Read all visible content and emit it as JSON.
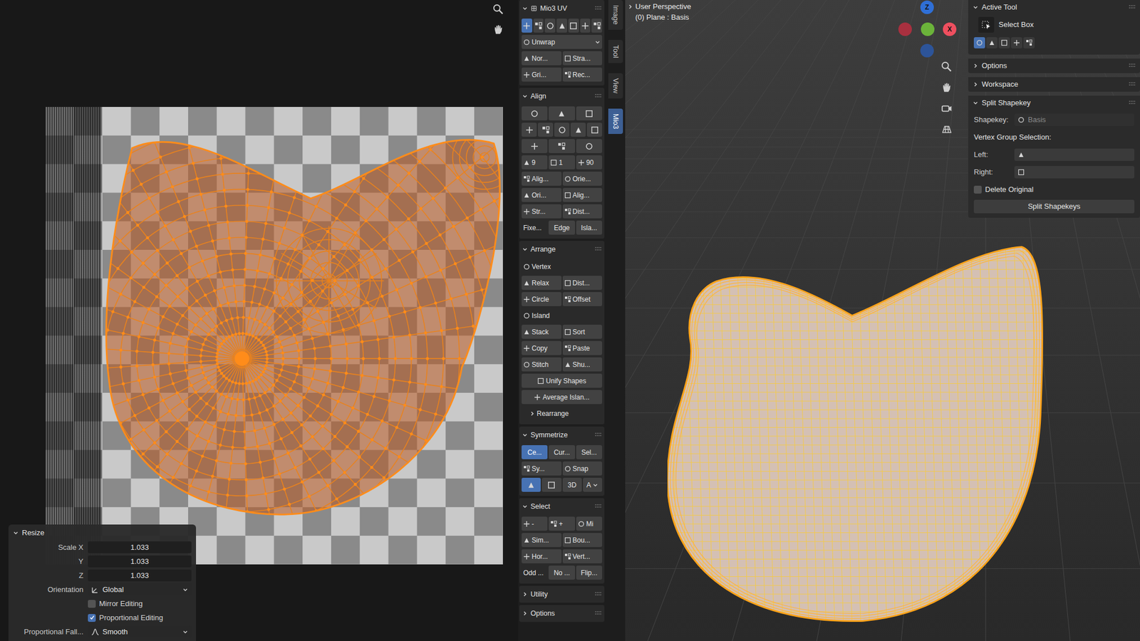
{
  "uv_editor": {
    "operator_panel": {
      "title": "Resize",
      "expanded": true,
      "fields": [
        {
          "label": "Scale X",
          "value": "1.033"
        },
        {
          "label": "Y",
          "value": "1.033"
        },
        {
          "label": "Z",
          "value": "1.033"
        }
      ],
      "orientation": {
        "label": "Orientation",
        "value": "Global"
      },
      "checkboxes": [
        {
          "label": "Mirror Editing",
          "checked": false
        },
        {
          "label": "Proportional Editing",
          "checked": true
        }
      ],
      "falloff": {
        "label": "Proportional Fall...",
        "value": "Smooth"
      }
    }
  },
  "mio3_panel": {
    "sections": [
      {
        "title": "Mio3 UV",
        "expanded": true,
        "rows": [
          [
            {
              "kind": "icon",
              "selected": true
            },
            {
              "kind": "icon",
              "selected": false
            },
            {
              "kind": "icon",
              "selected": false
            },
            {
              "kind": "icon",
              "selected": false
            },
            {
              "kind": "icon",
              "selected": false
            },
            {
              "kind": "icon",
              "selected": false
            },
            {
              "kind": "icon",
              "selected": false
            }
          ],
          [
            {
              "kind": "dropdown",
              "label": "Unwrap"
            }
          ],
          [
            {
              "kind": "button",
              "label": "Nor..."
            },
            {
              "kind": "button",
              "label": "Stra..."
            }
          ],
          [
            {
              "kind": "button",
              "label": "Gri..."
            },
            {
              "kind": "button",
              "label": "Rec..."
            }
          ]
        ]
      },
      {
        "title": "Align",
        "expanded": true,
        "rows": [
          [
            {
              "kind": "icon"
            },
            {
              "kind": "icon"
            },
            {
              "kind": "icon"
            }
          ],
          [
            {
              "kind": "icon"
            },
            {
              "kind": "icon"
            },
            {
              "kind": "icon"
            },
            {
              "kind": "icon"
            },
            {
              "kind": "icon"
            }
          ],
          [
            {
              "kind": "icon"
            },
            {
              "kind": "icon"
            },
            {
              "kind": "icon"
            }
          ],
          [
            {
              "kind": "button",
              "label": "9"
            },
            {
              "kind": "button",
              "label": "1"
            },
            {
              "kind": "button",
              "label": "90"
            }
          ],
          [
            {
              "kind": "button",
              "label": "Alig..."
            },
            {
              "kind": "button",
              "label": "Orie..."
            }
          ],
          [
            {
              "kind": "button",
              "label": "Ori..."
            },
            {
              "kind": "button",
              "label": "Alig..."
            }
          ],
          [
            {
              "kind": "button",
              "label": "Str..."
            },
            {
              "kind": "button",
              "label": "Dist..."
            }
          ],
          [
            {
              "kind": "label",
              "label": "Fixe..."
            },
            {
              "kind": "plain",
              "label": "Edge"
            },
            {
              "kind": "plain",
              "label": "Isla..."
            }
          ]
        ]
      },
      {
        "title": "Arrange",
        "expanded": true,
        "rows": [
          [
            {
              "kind": "heading",
              "label": "Vertex"
            }
          ],
          [
            {
              "kind": "button",
              "label": "Relax"
            },
            {
              "kind": "button",
              "label": "Dist..."
            }
          ],
          [
            {
              "kind": "button",
              "label": "Circle"
            },
            {
              "kind": "button",
              "label": "Offset"
            }
          ],
          [
            {
              "kind": "heading",
              "label": "Island"
            }
          ],
          [
            {
              "kind": "button",
              "label": "Stack"
            },
            {
              "kind": "button",
              "label": "Sort"
            }
          ],
          [
            {
              "kind": "button",
              "label": "Copy"
            },
            {
              "kind": "button",
              "label": "Paste"
            }
          ],
          [
            {
              "kind": "button",
              "label": "Stitch"
            },
            {
              "kind": "button",
              "label": "Shu..."
            }
          ],
          [
            {
              "kind": "button",
              "label": "Unify Shapes"
            }
          ],
          [
            {
              "kind": "button",
              "label": "Average Islan..."
            }
          ],
          [
            {
              "kind": "subpanel",
              "label": "Rearrange",
              "expanded": false
            }
          ]
        ]
      },
      {
        "title": "Symmetrize",
        "expanded": true,
        "rows": [
          [
            {
              "kind": "toggle",
              "label": "Ce...",
              "selected": true
            },
            {
              "kind": "toggle",
              "label": "Cur...",
              "selected": false
            },
            {
              "kind": "toggle",
              "label": "Sel...",
              "selected": false
            }
          ],
          [
            {
              "kind": "button",
              "label": "Sy..."
            },
            {
              "kind": "button",
              "label": "Snap"
            }
          ],
          [
            {
              "kind": "icon",
              "selected": true
            },
            {
              "kind": "icon",
              "selected": false
            },
            {
              "kind": "plain",
              "label": "3D"
            },
            {
              "kind": "dropdown",
              "label": "A"
            }
          ]
        ]
      },
      {
        "title": "Select",
        "expanded": true,
        "rows": [
          [
            {
              "kind": "button",
              "label": "-"
            },
            {
              "kind": "button",
              "label": "+"
            },
            {
              "kind": "button",
              "label": "Mi"
            }
          ],
          [
            {
              "kind": "button",
              "label": "Sim..."
            },
            {
              "kind": "button",
              "label": "Bou..."
            }
          ],
          [
            {
              "kind": "button",
              "label": "Hor..."
            },
            {
              "kind": "button",
              "label": "Vert..."
            }
          ],
          [
            {
              "kind": "label",
              "label": "Odd ..."
            },
            {
              "kind": "plain",
              "label": "No ..."
            },
            {
              "kind": "plain",
              "label": "Flip..."
            }
          ]
        ]
      },
      {
        "title": "Utility",
        "expanded": false,
        "rows": []
      },
      {
        "title": "Options",
        "expanded": false,
        "rows": []
      }
    ]
  },
  "side_tabs": [
    {
      "label": "Image",
      "selected": false
    },
    {
      "label": "Tool",
      "selected": false
    },
    {
      "label": "View",
      "selected": false
    },
    {
      "label": "Mio3",
      "selected": true
    }
  ],
  "viewport": {
    "lines": [
      "User Perspective",
      "(0) Plane : Basis"
    ],
    "gizmo": [
      {
        "kind": "axis",
        "label": "Z",
        "color": "#2f6fd6"
      },
      {
        "kind": "axis",
        "label": "X",
        "color": "#ef4f5f"
      },
      {
        "kind": "ball",
        "color": "#6bb33a"
      },
      {
        "kind": "ball",
        "color": "#a8303f"
      },
      {
        "kind": "ball",
        "color": "#2d5499"
      }
    ]
  },
  "n_panel": {
    "active_tool": {
      "title": "Active Tool",
      "expanded": true,
      "tool": "Select Box",
      "modes": [
        {
          "selected": true
        },
        {
          "selected": false
        },
        {
          "selected": false
        },
        {
          "selected": false
        },
        {
          "selected": false
        }
      ]
    },
    "collapsed": [
      {
        "title": "Options",
        "expanded": false
      },
      {
        "title": "Workspace",
        "expanded": false
      }
    ],
    "split_shapekey": {
      "title": "Split Shapekey",
      "expanded": true,
      "shapekey_label": "Shapekey:",
      "shapekey_value": "Basis",
      "shapekey_disabled": true,
      "group_heading": "Vertex Group Selection:",
      "left_label": "Left:",
      "right_label": "Right:",
      "delete_original": {
        "label": "Delete Original",
        "checked": false
      },
      "button": "Split Shapekeys"
    }
  }
}
